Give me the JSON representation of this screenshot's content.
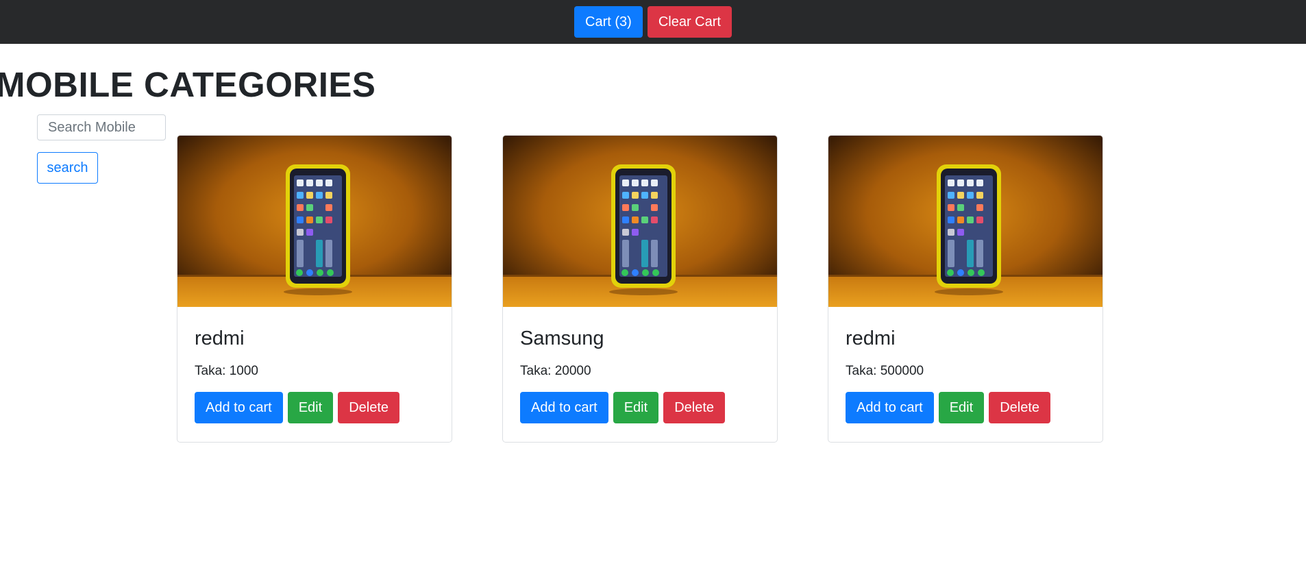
{
  "topbar": {
    "cart_label": "Cart (3)",
    "clear_cart_label": "Clear Cart"
  },
  "page": {
    "title": "MOBILE CATEGORIES"
  },
  "search": {
    "placeholder": "Search Mobile",
    "value": "",
    "button_label": "search"
  },
  "products": [
    {
      "name": "redmi",
      "price": "Taka: 1000",
      "add_label": "Add to cart",
      "edit_label": "Edit",
      "delete_label": "Delete"
    },
    {
      "name": "Samsung",
      "price": "Taka: 20000",
      "add_label": "Add to cart",
      "edit_label": "Edit",
      "delete_label": "Delete"
    },
    {
      "name": "redmi",
      "price": "Taka: 500000",
      "add_label": "Add to cart",
      "edit_label": "Edit",
      "delete_label": "Delete"
    }
  ],
  "colors": {
    "navbar": "#28292b",
    "primary": "#0d7bff",
    "danger": "#dc3545",
    "success": "#28a745"
  }
}
